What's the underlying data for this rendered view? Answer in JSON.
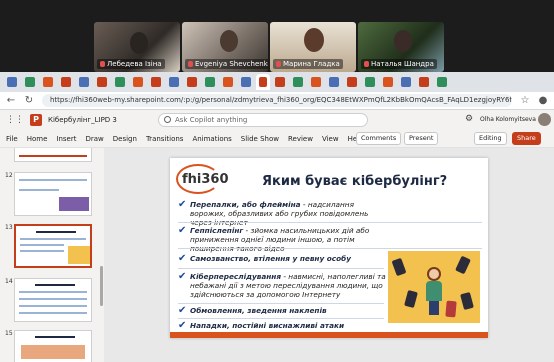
{
  "meeting": {
    "participants": [
      {
        "name": "Лебедева Ізіна"
      },
      {
        "name": "Evgeniya Shevchenko"
      },
      {
        "name": "Марина Гладка"
      },
      {
        "name": "Наталья Шандра"
      }
    ]
  },
  "browser": {
    "url": "https://fhi360web-my.sharepoint.com/:p:/g/personal/zdmytrieva_fhi360_org/EQC348EtWXPmQfL2KbBkOmQAcsB_FAqLD1ezgjoyRY6fdk?e..."
  },
  "app": {
    "doc_title": "Кібербулінг_LIPD 3",
    "search_placeholder": "Search",
    "search_label": "Ask Copilot anything",
    "user_name": "Olha Kolomyitseva"
  },
  "ribbon": {
    "tabs": [
      "File",
      "Home",
      "Insert",
      "Draw",
      "Design",
      "Transitions",
      "Animations",
      "Slide Show",
      "Review",
      "View",
      "Help"
    ],
    "comments_label": "Comments",
    "present_label": "Present",
    "editing_label": "Editing",
    "share_label": "Share"
  },
  "thumbnails": {
    "numbers": [
      "12",
      "13",
      "14",
      "15"
    ],
    "active": "13"
  },
  "slide": {
    "logo": "fhi360",
    "title": "Яким буває кібербулінг?",
    "bullets": [
      {
        "bold": "Перепалки, або флейміна",
        "rest": " - надсилання ворожих, образливих або грубих повідомлень через інтернет"
      },
      {
        "bold": "Геппіслепінг",
        "rest": " - зйомка насильницьких дій або приниження однієї людини іншою, а потім поширення такого відео"
      },
      {
        "bold": "Самозванство, втілення у певну особу",
        "rest": ""
      },
      {
        "bold": "Кіберпереслідування",
        "rest": " - навмисні, наполегливі та небажані дії з метою переслідування людини, що здійснюються за допомогою Інтернету"
      },
      {
        "bold": "Обмовлення, зведення наклепів",
        "rest": ""
      },
      {
        "bold": "Нападки, постійні виснажливі атаки",
        "rest": ""
      }
    ]
  },
  "colors": {
    "accent": "#c43e1c",
    "slide_accent": "#d9531e",
    "heading": "#1e2a44",
    "check": "#1a4b9c"
  }
}
